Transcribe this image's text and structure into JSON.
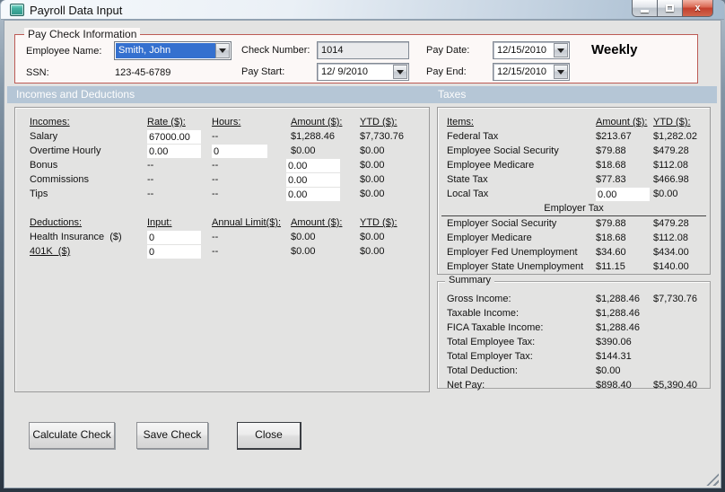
{
  "window": {
    "title": "Payroll Data Input",
    "close_glyph": "x"
  },
  "colors": {
    "section_header_bg": "#b5c6d6",
    "paycheck_border": "#bd5b55",
    "combo_selection_blue": "#3470cf",
    "close_button_red": "#c33f2d"
  },
  "paycheck_info": {
    "legend": "Pay Check Information",
    "employee_name_label": "Employee Name:",
    "employee_name_value": "Smith, John",
    "ssn_label": "SSN:",
    "ssn_value": "123-45-6789",
    "check_number_label": "Check Number:",
    "check_number_value": "1014",
    "pay_start_label": "Pay Start:",
    "pay_start_value": "12/ 9/2010",
    "pay_date_label": "Pay Date:",
    "pay_date_value": "12/15/2010",
    "pay_end_label": "Pay End:",
    "pay_end_value": "12/15/2010",
    "frequency": "Weekly"
  },
  "section_headers": {
    "left": "Incomes and Deductions",
    "right": "Taxes"
  },
  "incomes": {
    "headers": {
      "c0": "Incomes:",
      "c1": "Rate ($):",
      "c2": "Hours:",
      "c3": "Amount ($):",
      "c4": "YTD ($):"
    },
    "rows": [
      {
        "label": "Salary",
        "rate": "67000.00",
        "hours": "--",
        "amount": "$1,288.46",
        "ytd": "$7,730.76"
      },
      {
        "label": "Overtime Hourly",
        "rate": "0.00",
        "hours": "0",
        "amount": "$0.00",
        "ytd": "$0.00"
      },
      {
        "label": "Bonus",
        "rate": "--",
        "hours": "--",
        "amount": "0.00",
        "ytd": "$0.00"
      },
      {
        "label": "Commissions",
        "rate": "--",
        "hours": "--",
        "amount": "0.00",
        "ytd": "$0.00"
      },
      {
        "label": "Tips",
        "rate": "--",
        "hours": "--",
        "amount": "0.00",
        "ytd": "$0.00"
      }
    ]
  },
  "deductions": {
    "headers": {
      "c0": "Deductions:",
      "c1": "Input:",
      "c2": "Annual Limit($):",
      "c3": "Amount ($):",
      "c4": "YTD ($):"
    },
    "rows": [
      {
        "label": "Health Insurance  ($)",
        "input": "0",
        "limit": "--",
        "amount": "$0.00",
        "ytd": "$0.00"
      },
      {
        "label": "401K  ($)",
        "input": "0",
        "limit": "--",
        "amount": "$0.00",
        "ytd": "$0.00"
      }
    ]
  },
  "taxes": {
    "headers": {
      "c0": "Items:",
      "c1": "Amount ($):",
      "c2": "YTD ($):"
    },
    "employee_rows": [
      {
        "label": "Federal Tax",
        "amount": "$213.67",
        "ytd": "$1,282.02"
      },
      {
        "label": "Employee Social Security",
        "amount": "$79.88",
        "ytd": "$479.28"
      },
      {
        "label": "Employee Medicare",
        "amount": "$18.68",
        "ytd": "$112.08"
      },
      {
        "label": "State Tax",
        "amount": "$77.83",
        "ytd": "$466.98"
      },
      {
        "label": "Local Tax",
        "amount": "0.00",
        "ytd": "$0.00"
      }
    ],
    "employer_header": "Employer Tax",
    "employer_rows": [
      {
        "label": "Employer Social Security",
        "amount": "$79.88",
        "ytd": "$479.28"
      },
      {
        "label": "Employer Medicare",
        "amount": "$18.68",
        "ytd": "$112.08"
      },
      {
        "label": "Employer Fed Unemployment",
        "amount": "$34.60",
        "ytd": "$434.00"
      },
      {
        "label": "Employer State Unemployment",
        "amount": "$11.15",
        "ytd": "$140.00"
      }
    ]
  },
  "summary": {
    "legend": "Summary",
    "rows": [
      {
        "label": "Gross Income:",
        "amount": "$1,288.46",
        "ytd": "$7,730.76"
      },
      {
        "label": "Taxable Income:",
        "amount": "$1,288.46",
        "ytd": ""
      },
      {
        "label": "FICA Taxable Income:",
        "amount": "$1,288.46",
        "ytd": ""
      },
      {
        "label": "Total Employee Tax:",
        "amount": "$390.06",
        "ytd": ""
      },
      {
        "label": "Total Employer Tax:",
        "amount": "$144.31",
        "ytd": ""
      },
      {
        "label": "Total Deduction:",
        "amount": "$0.00",
        "ytd": ""
      },
      {
        "label": "Net Pay:",
        "amount": "$898.40",
        "ytd": "$5,390.40"
      }
    ]
  },
  "buttons": {
    "calculate": "Calculate Check",
    "save": "Save Check",
    "close": "Close"
  }
}
